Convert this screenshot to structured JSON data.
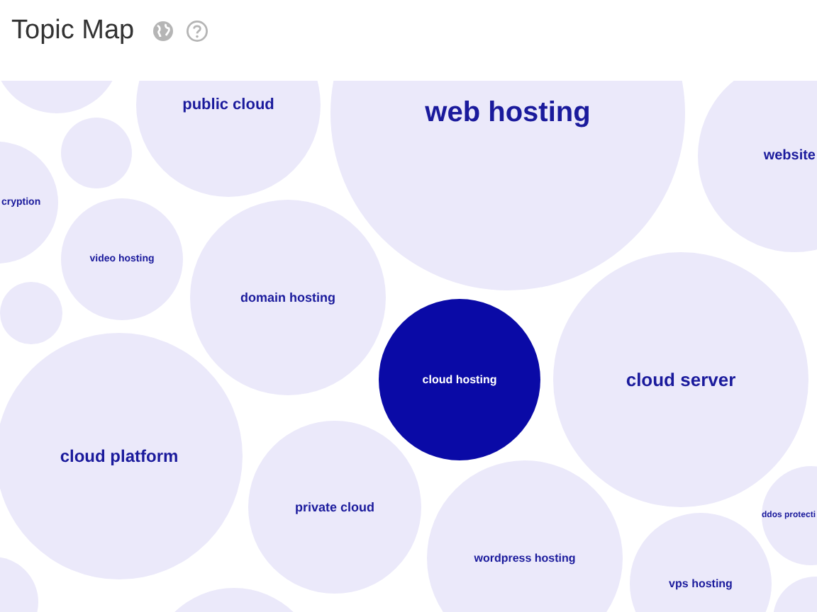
{
  "header": {
    "title": "Topic Map"
  },
  "bubbles": [
    {
      "selected": false
    },
    {
      "label": "public cloud",
      "selected": false
    },
    {
      "label": "web hosting",
      "selected": false
    },
    {
      "label": "website",
      "selected": false
    },
    {
      "selected": false
    },
    {
      "label": "cryption",
      "selected": false
    },
    {
      "label": "video hosting",
      "selected": false
    },
    {
      "label": "domain hosting",
      "selected": false
    },
    {
      "selected": false
    },
    {
      "label": "cloud hosting",
      "selected": true
    },
    {
      "label": "cloud server",
      "selected": false
    },
    {
      "label": "cloud platform",
      "selected": false
    },
    {
      "label": "private cloud",
      "selected": false
    },
    {
      "label": "wordpress hosting",
      "selected": false
    },
    {
      "label": "vps hosting",
      "selected": false
    },
    {
      "label": "ddos protecti",
      "selected": false
    },
    {
      "selected": false
    },
    {
      "selected": false
    },
    {
      "selected": false
    }
  ]
}
